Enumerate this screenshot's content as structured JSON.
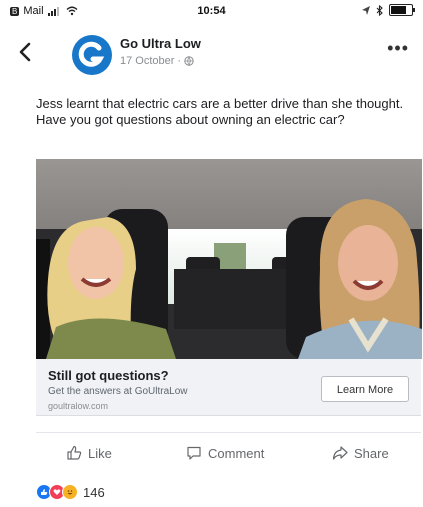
{
  "status_bar": {
    "app_badge": "B",
    "carrier": "Mail",
    "time": "10:54",
    "battery_level": 0.85
  },
  "post": {
    "page_name": "Go Ultra Low",
    "date": "17 October",
    "text": "Jess learnt that electric cars are a better drive than she thought. Have you got questions about owning an electric car?"
  },
  "link_card": {
    "title": "Still got questions?",
    "description": "Get the answers at GoUltraLow",
    "domain": "goultralow.com",
    "cta_label": "Learn More"
  },
  "actions": {
    "like": "Like",
    "comment": "Comment",
    "share": "Share"
  },
  "reactions": {
    "count": "146",
    "icons": [
      "like-icon",
      "love-icon",
      "haha-icon"
    ],
    "colors": [
      "#1877f2",
      "#f33e58",
      "#f7b125"
    ]
  },
  "colors": {
    "brand": "#1877c9",
    "card_bg": "#f0f2f5",
    "muted_text": "#65676b"
  }
}
